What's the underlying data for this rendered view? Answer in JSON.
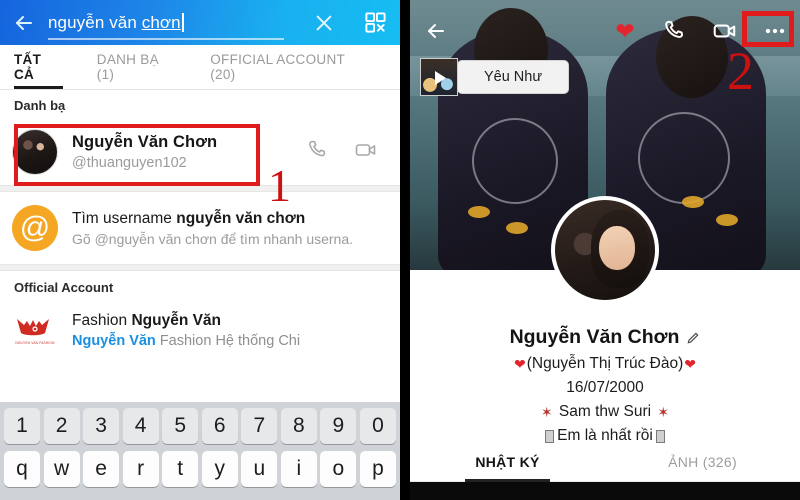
{
  "left": {
    "search": {
      "back_icon": "back-arrow-icon",
      "value_plain": "nguyễn văn ",
      "value_composing": "chơn",
      "clear_icon": "close-icon",
      "qr_icon": "qr-scan-icon"
    },
    "tabs": [
      {
        "label": "TẤT CẢ",
        "active": true
      },
      {
        "label": "DANH BẠ (1)",
        "active": false
      },
      {
        "label": "OFFICIAL ACCOUNT (20)",
        "active": false
      }
    ],
    "contacts_section": {
      "heading": "Danh bạ",
      "contact": {
        "name": "Nguyễn Văn Chơn",
        "handle": "@thuanguyen102",
        "call_icon": "phone-icon",
        "video_icon": "video-camera-icon"
      }
    },
    "username_search": {
      "at_icon": "at-sign-icon",
      "title_prefix": "Tìm username ",
      "title_query": "nguyễn văn chơn",
      "subtitle": "Gõ @nguyễn văn chơn để tìm nhanh userna."
    },
    "official_section": {
      "heading": "Official Account",
      "item": {
        "logo_caption": "NGUYEN VAN FASHION",
        "title_prefix": "Fashion ",
        "title_bold": "Nguyễn Văn",
        "sub_highlight": "Nguyễn Văn",
        "sub_rest": " Fashion Hệ thống Chi"
      }
    },
    "keyboard": {
      "digits": [
        "1",
        "2",
        "3",
        "4",
        "5",
        "6",
        "7",
        "8",
        "9",
        "0"
      ],
      "letters": [
        "q",
        "w",
        "e",
        "r",
        "t",
        "y",
        "u",
        "i",
        "o",
        "p"
      ]
    },
    "annotation": {
      "marker": "1"
    }
  },
  "right": {
    "cover": {
      "back_icon": "back-arrow-icon",
      "heart_icon": "heart-icon",
      "call_icon": "phone-icon",
      "video_icon": "video-camera-icon",
      "more_icon": "more-options-icon"
    },
    "story": {
      "label": "Yêu Như",
      "play_icon": "play-icon"
    },
    "profile": {
      "name": "Nguyễn Văn Chơn",
      "edit_icon": "pencil-edit-icon",
      "bio_line_1": "(Nguyễn Thị Trúc Đào)",
      "bio_line_2": "16/07/2000",
      "bio_line_3": "Sam thw Suri",
      "bio_line_4": "Em là nhất rồi"
    },
    "tabs": [
      {
        "label": "NHẬT KÝ",
        "active": true
      },
      {
        "label": "ẢNH (326)",
        "active": false
      }
    ],
    "annotation": {
      "marker": "2"
    }
  },
  "colors": {
    "header_blue_start": "#1565dd",
    "header_blue_end": "#16bdf3",
    "annotation_red": "#e01b1b",
    "marker_red": "#cc1111",
    "at_orange": "#f5a623",
    "link_blue": "#1a8fe0",
    "heart_red": "#e3262d"
  }
}
